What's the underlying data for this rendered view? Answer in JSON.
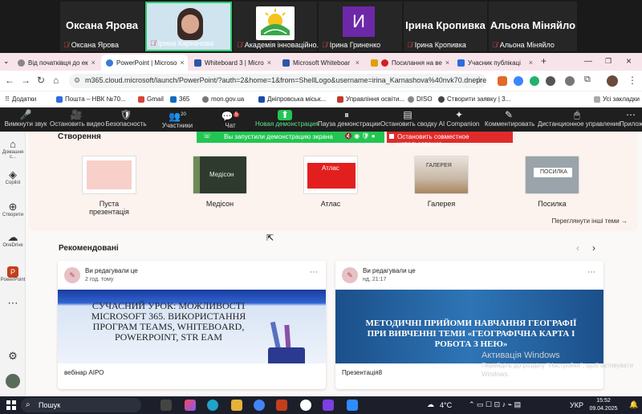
{
  "gallery": [
    {
      "big": "Оксана Ярова",
      "cap": "Оксана Ярова"
    },
    {
      "big": "",
      "cap": "Ірина Карначова"
    },
    {
      "big": "",
      "cap": "Академія інноваційно..."
    },
    {
      "big": "И",
      "cap": "Ірина Гриненко"
    },
    {
      "big": "Ірина Кропивка",
      "cap": "Ірина Кропивка"
    },
    {
      "big": "Альона Міняйло",
      "cap": "Альона Міняйло"
    }
  ],
  "tabs": [
    "Від початківця до ек",
    "PowerPoint | Microso",
    "Whiteboard 3 | Micro",
    "Microsoft Whiteboar",
    "Посилання на ве",
    "Учасник публікаці"
  ],
  "tab_new": "+",
  "address": {
    "url": "m365.cloud.microsoft/launch/PowerPoint/?auth=2&home=1&from=ShellLogo&username=irina_Karnashova%40nvk70.dnepred..."
  },
  "bookmarks": [
    "Додатки",
    "Пошта – НВК №70...",
    "Gmail",
    "365",
    "mon.gov.ua",
    "Дніпровська міськ...",
    "Управління освіти...",
    "DISO",
    "Створити заявку | 3...",
    "Усі закладки"
  ],
  "zoom_toolbar": [
    {
      "icon": "🎤",
      "label": "Вимкнути звук"
    },
    {
      "icon": "🎥",
      "label": "Остановить видео"
    },
    {
      "icon": "🛡",
      "label": "Безопасность"
    },
    {
      "icon": "👥",
      "label": "Участники",
      "badge": "20"
    },
    {
      "icon": "💬",
      "label": "Чат",
      "badge": "5"
    },
    {
      "icon": "⬆",
      "label": "Новая демонстрация"
    },
    {
      "icon": "⏸",
      "label": "Пауза демонстрации"
    },
    {
      "icon": "▤",
      "label": "Остановить сводку"
    },
    {
      "icon": "✦",
      "label": "AI Companion"
    },
    {
      "icon": "✎",
      "label": "Комментировать"
    },
    {
      "icon": "🖱",
      "label": "Дистанционное управление"
    },
    {
      "icon": "⋯",
      "label": "Прилож"
    }
  ],
  "share": {
    "green": "Вы запустили демонстрацию экрана",
    "red": "Остановить совместное использование"
  },
  "left_rail": [
    "Домашня с...",
    "Copilot",
    "Створити",
    "OneDrive",
    "PowerPoint",
    "",
    ""
  ],
  "create": {
    "heading": "Створення",
    "more": "Переглянути інші теми →",
    "templates": [
      {
        "name": "Пуста презентація",
        "thumb_text": ""
      },
      {
        "name": "Медісон",
        "thumb_text": "Медісон"
      },
      {
        "name": "Атлас",
        "thumb_text": "Атлас"
      },
      {
        "name": "Галерея",
        "thumb_text": "ГАЛЕРЕЯ"
      },
      {
        "name": "Посилка",
        "thumb_text": "ПОСИЛКА"
      }
    ]
  },
  "recommended": {
    "heading": "Рекомендовані",
    "prev": "‹",
    "next": "›",
    "cards": [
      {
        "who": "Ви редагували це",
        "when": "2 год. тому",
        "title": "СУЧАСНИЙ УРОК: МОЖЛИВОСТІ MICROSOFT 365. ВИКОРИСТАННЯ ПРОГРАМ TEAMS, WHITEBOARD, POWERPOINT, STR EAM",
        "name": "вебінар АІРО"
      },
      {
        "who": "Ви редагували це",
        "when": "нд, 21:17",
        "title": "МЕТОДИЧНІ ПРИЙОМИ НАВЧАННЯ ГЕОГРАФІЇ ПРИ ВИВЧЕННІ ТЕМИ «ГЕОГРАФІЧНА КАРТА І РОБОТА З НЕЮ»",
        "name": "Презентація8"
      }
    ]
  },
  "watermark": {
    "line1": "Активація Windows",
    "line2": "Перейдіть до розділу \"Настройки\", щоб активувати Windows."
  },
  "taskbar": {
    "search": "Пошук",
    "temp": "4°C",
    "lang": "УКР",
    "time": "15:52",
    "date": "09.04.2025"
  }
}
